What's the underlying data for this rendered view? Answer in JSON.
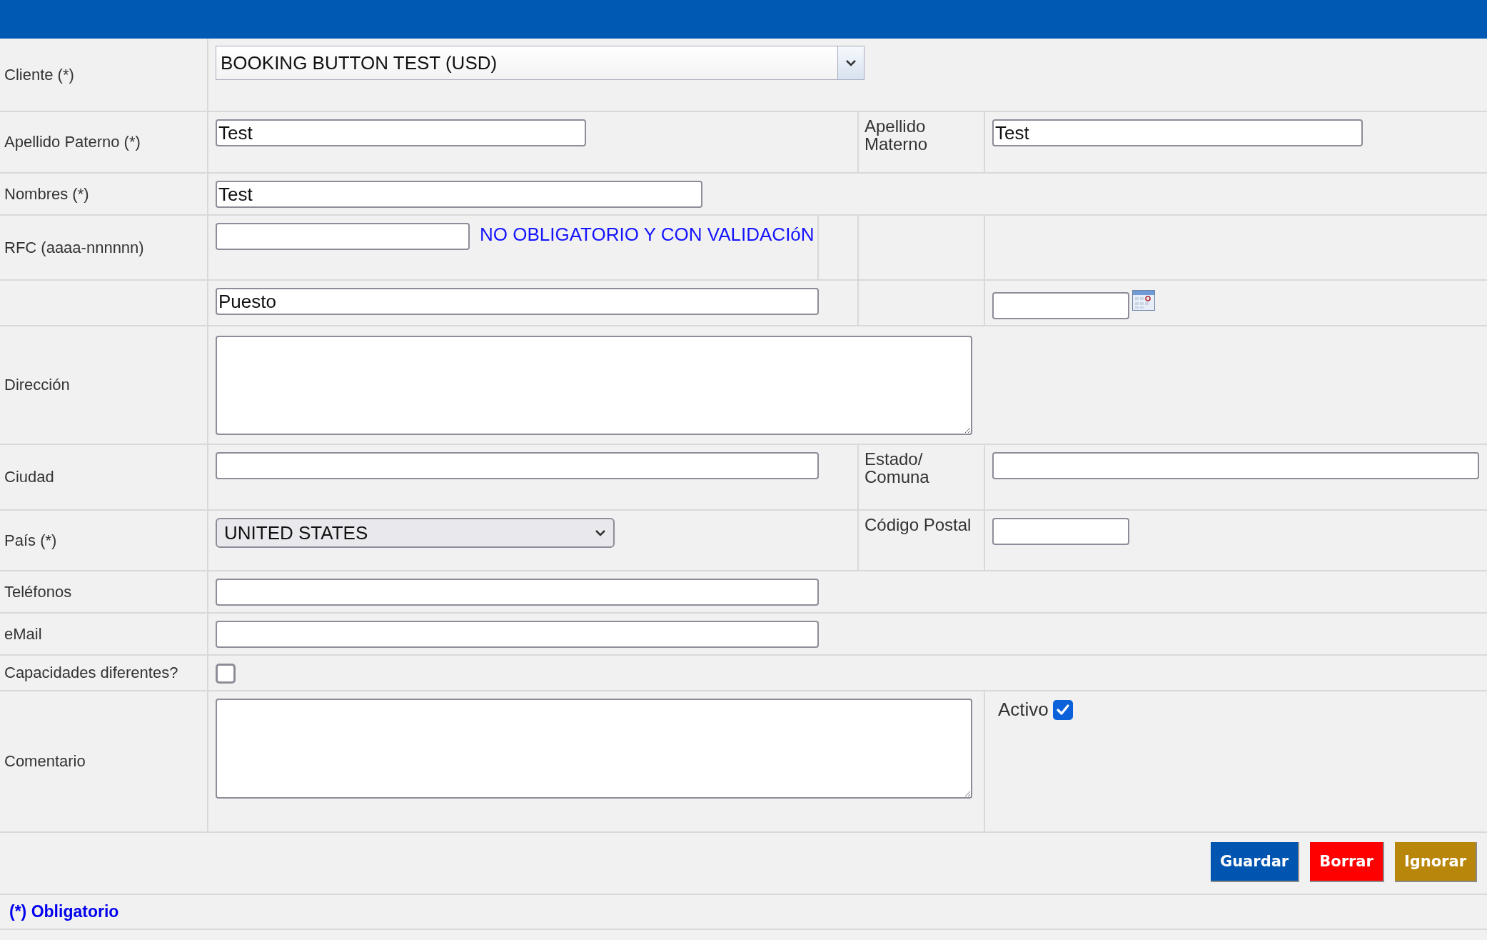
{
  "rows": [
    {
      "kind": "client",
      "label": "Cliente (*)",
      "value": "BOOKING BUTTON TEST (USD)"
    },
    {
      "kind": "names",
      "label": "Apellido Paterno (*)",
      "value": "Test",
      "label_2": "Apellido Materno",
      "value_2": "Test"
    },
    {
      "kind": "name",
      "label": "Nombres (*)",
      "value": "Test"
    },
    {
      "kind": "rfc",
      "label": "RFC (aaaa-nnnnnn)",
      "note": "NO OBLIGATORIO Y CON VALIDACIóN"
    },
    {
      "kind": "position",
      "value": "Puesto"
    },
    {
      "kind": "address",
      "label": "Dirección"
    },
    {
      "kind": "region",
      "label": "Ciudad",
      "label_2": "Estado/ Comuna"
    },
    {
      "kind": "country",
      "label": "País (*)",
      "value": "UNITED STATES",
      "label_2": "Código Postal"
    },
    {
      "kind": "contact",
      "label": "Teléfonos"
    },
    {
      "kind": "contact",
      "label": "eMail"
    },
    {
      "kind": "checkbox",
      "label": "Capacidades diferentes?",
      "checked": false
    },
    {
      "kind": "comment",
      "label": "Comentario",
      "check_label": "Activo",
      "checked": true
    }
  ],
  "buttons": [
    {
      "label": "Guardar",
      "color": "#0055b0"
    },
    {
      "label": "Borrar",
      "color": "#ff0000"
    },
    {
      "label": "Ignorar",
      "color": "#b8860b"
    }
  ],
  "footnote": "(*) Obligatorio"
}
